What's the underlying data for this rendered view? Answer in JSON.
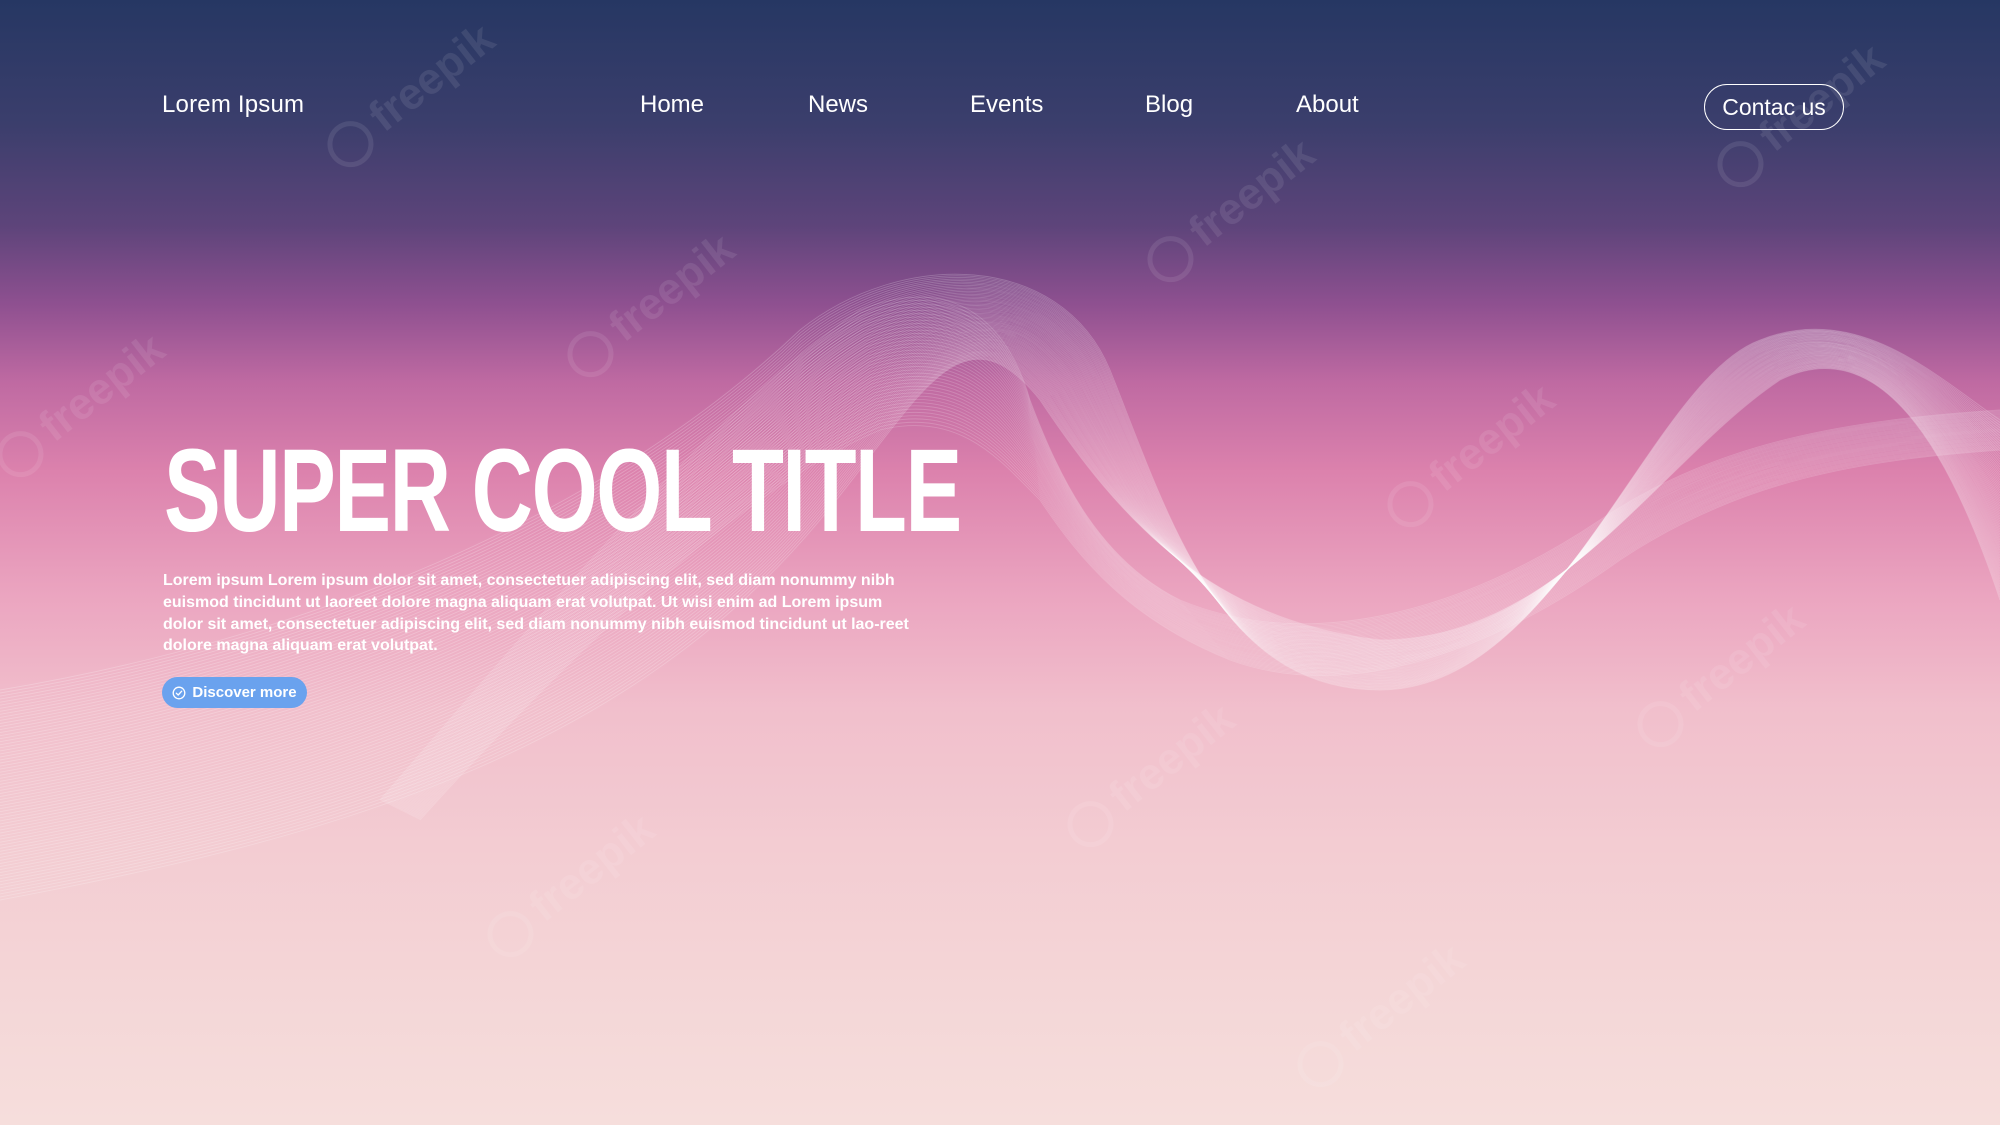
{
  "header": {
    "brand": "Lorem Ipsum",
    "nav": [
      {
        "label": "Home"
      },
      {
        "label": "News"
      },
      {
        "label": "Events"
      },
      {
        "label": "Blog"
      },
      {
        "label": "About"
      }
    ],
    "contact_label": "Contac us"
  },
  "hero": {
    "title": "SUPER COOL TITLE",
    "body": "Lorem ipsum Lorem ipsum dolor sit amet, consectetuer adipiscing elit, sed diam nonummy nibh euismod tincidunt ut laoreet dolore magna aliquam erat volutpat. Ut wisi enim ad Lorem ipsum dolor sit amet, consectetuer adipiscing elit, sed diam nonummy nibh euismod tincidunt ut lao-reet dolore magna aliquam erat volutpat.",
    "cta": {
      "label": "Discover more",
      "icon": "check-circle-icon",
      "color": "#6aa2ee"
    }
  },
  "watermark": "freepik",
  "colors": {
    "gradient_top": "#263763",
    "gradient_mid": "#dc82ad",
    "gradient_bottom": "#f6dedc",
    "text": "#ffffff"
  }
}
